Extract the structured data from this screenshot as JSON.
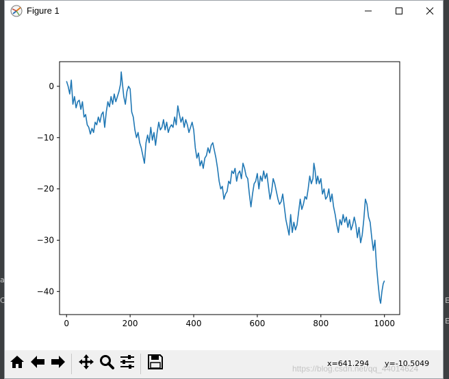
{
  "window": {
    "title": "Figure 1",
    "icons": {
      "app": "matplotlib-icon",
      "minimize": "minimize-icon",
      "maximize": "maximize-icon",
      "close": "close-icon"
    }
  },
  "background": {
    "left_glyphs": [
      "a",
      "C"
    ],
    "right_glyphs": [
      "E",
      "E"
    ]
  },
  "toolbar": {
    "buttons": [
      {
        "name": "home",
        "icon": "home-icon"
      },
      {
        "name": "back",
        "icon": "arrow-left-icon"
      },
      {
        "name": "forward",
        "icon": "arrow-right-icon"
      },
      {
        "name": "pan",
        "icon": "move-icon"
      },
      {
        "name": "zoom",
        "icon": "magnifier-icon"
      },
      {
        "name": "subplots",
        "icon": "sliders-icon"
      },
      {
        "name": "save",
        "icon": "save-icon"
      }
    ],
    "x_readout": "x=641.294",
    "y_readout": "y=-10.5049",
    "watermark": "https://blog.csdn.net/qq_44014624"
  },
  "chart_data": {
    "type": "line",
    "title": "",
    "xlabel": "",
    "ylabel": "",
    "xlim": [
      -22,
      1048
    ],
    "ylim": [
      -44.5,
      4.8
    ],
    "xticks": [
      0,
      200,
      400,
      600,
      800,
      1000
    ],
    "yticks": [
      0,
      -10,
      -20,
      -30,
      -40
    ],
    "xtick_labels": [
      "0",
      "200",
      "400",
      "600",
      "800",
      "1000"
    ],
    "ytick_labels": [
      "0",
      "−10",
      "−20",
      "−30",
      "−40"
    ],
    "grid": false,
    "line_color": "#1f77b4",
    "series": [
      {
        "points": [
          [
            0,
            1.0
          ],
          [
            5,
            0.0
          ],
          [
            10,
            -1.5
          ],
          [
            15,
            1.2
          ],
          [
            20,
            -3.5
          ],
          [
            25,
            -2.0
          ],
          [
            30,
            -4.2
          ],
          [
            35,
            -3.0
          ],
          [
            40,
            -2.7
          ],
          [
            45,
            -4.5
          ],
          [
            50,
            -3.0
          ],
          [
            55,
            -6.0
          ],
          [
            60,
            -5.5
          ],
          [
            65,
            -7.5
          ],
          [
            70,
            -8.0
          ],
          [
            75,
            -9.3
          ],
          [
            80,
            -8.2
          ],
          [
            85,
            -9.0
          ],
          [
            90,
            -7.0
          ],
          [
            95,
            -7.5
          ],
          [
            100,
            -6.0
          ],
          [
            105,
            -7.0
          ],
          [
            110,
            -5.5
          ],
          [
            115,
            -5.0
          ],
          [
            120,
            -8.0
          ],
          [
            125,
            -5.0
          ],
          [
            130,
            -3.0
          ],
          [
            135,
            -4.0
          ],
          [
            140,
            -2.0
          ],
          [
            145,
            -3.5
          ],
          [
            150,
            -1.5
          ],
          [
            155,
            -3.0
          ],
          [
            160,
            -2.0
          ],
          [
            165,
            -1.0
          ],
          [
            170,
            0.5
          ],
          [
            172,
            2.8
          ],
          [
            175,
            1.0
          ],
          [
            180,
            -2.0
          ],
          [
            185,
            -3.5
          ],
          [
            190,
            -1.0
          ],
          [
            195,
            0.0
          ],
          [
            200,
            -0.5
          ],
          [
            205,
            -5.0
          ],
          [
            210,
            -6.0
          ],
          [
            215,
            -8.5
          ],
          [
            220,
            -10.0
          ],
          [
            225,
            -9.0
          ],
          [
            230,
            -11.0
          ],
          [
            235,
            -12.0
          ],
          [
            240,
            -13.5
          ],
          [
            245,
            -15.0
          ],
          [
            250,
            -11.0
          ],
          [
            255,
            -9.5
          ],
          [
            260,
            -11.0
          ],
          [
            265,
            -8.0
          ],
          [
            270,
            -10.5
          ],
          [
            275,
            -9.0
          ],
          [
            280,
            -11.5
          ],
          [
            285,
            -9.0
          ],
          [
            290,
            -7.0
          ],
          [
            295,
            -8.5
          ],
          [
            300,
            -8.0
          ],
          [
            305,
            -6.5
          ],
          [
            310,
            -8.5
          ],
          [
            315,
            -7.0
          ],
          [
            320,
            -9.0
          ],
          [
            325,
            -8.0
          ],
          [
            330,
            -7.5
          ],
          [
            335,
            -8.0
          ],
          [
            340,
            -6.0
          ],
          [
            345,
            -7.5
          ],
          [
            350,
            -3.8
          ],
          [
            355,
            -5.5
          ],
          [
            360,
            -7.0
          ],
          [
            365,
            -6.0
          ],
          [
            370,
            -8.0
          ],
          [
            375,
            -6.5
          ],
          [
            380,
            -7.5
          ],
          [
            385,
            -9.0
          ],
          [
            390,
            -8.0
          ],
          [
            395,
            -7.0
          ],
          [
            400,
            -8.5
          ],
          [
            405,
            -12.0
          ],
          [
            410,
            -14.0
          ],
          [
            415,
            -13.0
          ],
          [
            420,
            -15.5
          ],
          [
            425,
            -14.5
          ],
          [
            430,
            -16.0
          ],
          [
            435,
            -14.0
          ],
          [
            440,
            -13.5
          ],
          [
            445,
            -12.0
          ],
          [
            450,
            -13.0
          ],
          [
            455,
            -11.5
          ],
          [
            460,
            -11.0
          ],
          [
            465,
            -12.5
          ],
          [
            470,
            -14.0
          ],
          [
            475,
            -16.0
          ],
          [
            480,
            -18.5
          ],
          [
            485,
            -20.0
          ],
          [
            490,
            -19.5
          ],
          [
            495,
            -22.0
          ],
          [
            500,
            -21.0
          ],
          [
            505,
            -20.5
          ],
          [
            510,
            -18.5
          ],
          [
            515,
            -19.0
          ],
          [
            520,
            -16.5
          ],
          [
            525,
            -17.0
          ],
          [
            530,
            -16.0
          ],
          [
            535,
            -18.5
          ],
          [
            540,
            -17.0
          ],
          [
            545,
            -16.5
          ],
          [
            550,
            -18.0
          ],
          [
            555,
            -15.0
          ],
          [
            560,
            -16.0
          ],
          [
            565,
            -17.5
          ],
          [
            570,
            -18.0
          ],
          [
            575,
            -21.0
          ],
          [
            580,
            -23.5
          ],
          [
            585,
            -21.0
          ],
          [
            590,
            -19.0
          ],
          [
            595,
            -18.5
          ],
          [
            600,
            -17.0
          ],
          [
            605,
            -20.0
          ],
          [
            610,
            -17.5
          ],
          [
            615,
            -18.5
          ],
          [
            620,
            -16.5
          ],
          [
            625,
            -18.0
          ],
          [
            630,
            -17.0
          ],
          [
            635,
            -19.5
          ],
          [
            640,
            -22.0
          ],
          [
            645,
            -20.5
          ],
          [
            650,
            -18.0
          ],
          [
            655,
            -19.0
          ],
          [
            660,
            -20.5
          ],
          [
            665,
            -22.0
          ],
          [
            670,
            -23.0
          ],
          [
            675,
            -22.5
          ],
          [
            680,
            -21.0
          ],
          [
            685,
            -23.5
          ],
          [
            690,
            -26.0
          ],
          [
            695,
            -27.5
          ],
          [
            700,
            -29.0
          ],
          [
            705,
            -25.0
          ],
          [
            710,
            -28.5
          ],
          [
            715,
            -26.5
          ],
          [
            720,
            -28.0
          ],
          [
            725,
            -27.0
          ],
          [
            730,
            -24.5
          ],
          [
            735,
            -22.0
          ],
          [
            740,
            -24.0
          ],
          [
            745,
            -23.0
          ],
          [
            750,
            -21.5
          ],
          [
            755,
            -22.0
          ],
          [
            760,
            -20.0
          ],
          [
            765,
            -17.5
          ],
          [
            770,
            -19.0
          ],
          [
            775,
            -18.0
          ],
          [
            778,
            -15.0
          ],
          [
            782,
            -16.5
          ],
          [
            786,
            -19.0
          ],
          [
            790,
            -17.5
          ],
          [
            795,
            -19.0
          ],
          [
            800,
            -18.0
          ],
          [
            805,
            -21.0
          ],
          [
            810,
            -20.0
          ],
          [
            815,
            -22.0
          ],
          [
            820,
            -21.5
          ],
          [
            825,
            -20.0
          ],
          [
            830,
            -22.5
          ],
          [
            835,
            -21.0
          ],
          [
            840,
            -23.5
          ],
          [
            845,
            -25.0
          ],
          [
            850,
            -27.0
          ],
          [
            855,
            -28.5
          ],
          [
            860,
            -26.0
          ],
          [
            865,
            -27.0
          ],
          [
            870,
            -25.0
          ],
          [
            875,
            -26.5
          ],
          [
            880,
            -25.5
          ],
          [
            885,
            -27.5
          ],
          [
            890,
            -26.0
          ],
          [
            895,
            -28.0
          ],
          [
            900,
            -27.0
          ],
          [
            905,
            -25.5
          ],
          [
            910,
            -27.0
          ],
          [
            915,
            -29.5
          ],
          [
            920,
            -27.5
          ],
          [
            925,
            -30.5
          ],
          [
            930,
            -29.0
          ],
          [
            935,
            -26.0
          ],
          [
            940,
            -22.0
          ],
          [
            945,
            -23.0
          ],
          [
            950,
            -25.5
          ],
          [
            955,
            -26.5
          ],
          [
            960,
            -29.5
          ],
          [
            965,
            -32.0
          ],
          [
            970,
            -30.0
          ],
          [
            975,
            -35.0
          ],
          [
            980,
            -38.5
          ],
          [
            985,
            -41.5
          ],
          [
            988,
            -42.3
          ],
          [
            992,
            -40.0
          ],
          [
            996,
            -38.5
          ],
          [
            1000,
            -37.9
          ]
        ]
      }
    ]
  }
}
